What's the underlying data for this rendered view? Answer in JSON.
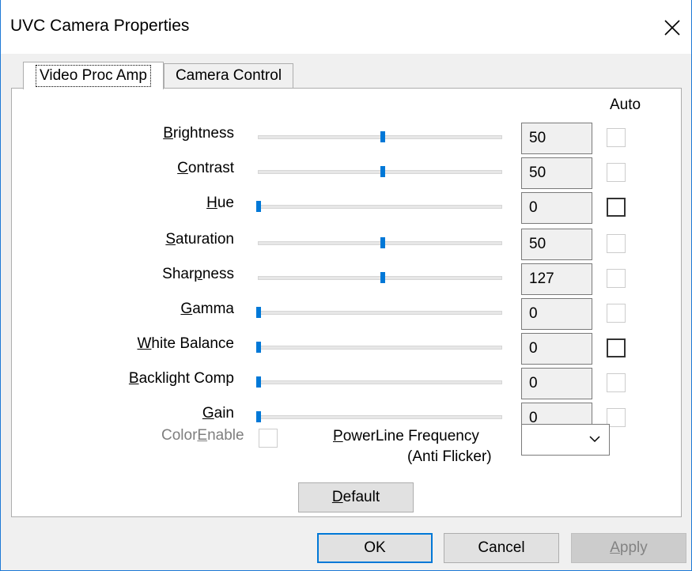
{
  "window": {
    "title": "UVC Camera Properties"
  },
  "tabs": [
    {
      "label": "Video Proc Amp",
      "active": true
    },
    {
      "label": "Camera Control",
      "active": false
    }
  ],
  "auto_header": "Auto",
  "properties": [
    {
      "label_pre": "",
      "label_u": "B",
      "label_post": "rightness",
      "value": "50",
      "slider_fraction": 0.5,
      "auto_enabled": false
    },
    {
      "label_pre": "",
      "label_u": "C",
      "label_post": "ontrast",
      "value": "50",
      "slider_fraction": 0.5,
      "auto_enabled": false
    },
    {
      "label_pre": "",
      "label_u": "H",
      "label_post": "ue",
      "value": "0",
      "slider_fraction": 0.0,
      "auto_enabled": true
    },
    {
      "label_pre": "",
      "label_u": "S",
      "label_post": "aturation",
      "value": "50",
      "slider_fraction": 0.5,
      "auto_enabled": false
    },
    {
      "label_pre": "Shar",
      "label_u": "p",
      "label_post": "ness",
      "value": "127",
      "slider_fraction": 0.5,
      "auto_enabled": false
    },
    {
      "label_pre": "",
      "label_u": "G",
      "label_post": "amma",
      "value": "0",
      "slider_fraction": 0.0,
      "auto_enabled": false
    },
    {
      "label_pre": "",
      "label_u": "W",
      "label_post": "hite Balance",
      "value": "0",
      "slider_fraction": 0.0,
      "auto_enabled": true
    },
    {
      "label_pre": "",
      "label_u": "B",
      "label_post": "acklight Comp",
      "value": "0",
      "slider_fraction": 0.0,
      "auto_enabled": false
    },
    {
      "label_pre": "",
      "label_u": "G",
      "label_post": "ain",
      "value": "0",
      "slider_fraction": 0.0,
      "auto_enabled": false
    }
  ],
  "color_enable": {
    "label_pre": "Color",
    "label_u": "E",
    "label_post": "nable"
  },
  "powerline": {
    "label_pre": "",
    "label_u": "P",
    "label_post": "owerLine Frequency",
    "label_line2": "(Anti Flicker)",
    "selected": ""
  },
  "buttons": {
    "default_u": "D",
    "default_post": "efault",
    "ok": "OK",
    "cancel": "Cancel",
    "apply_u": "A",
    "apply_post": "pply"
  },
  "colors": {
    "accent": "#0078d7",
    "border": "#1e7ad6"
  }
}
